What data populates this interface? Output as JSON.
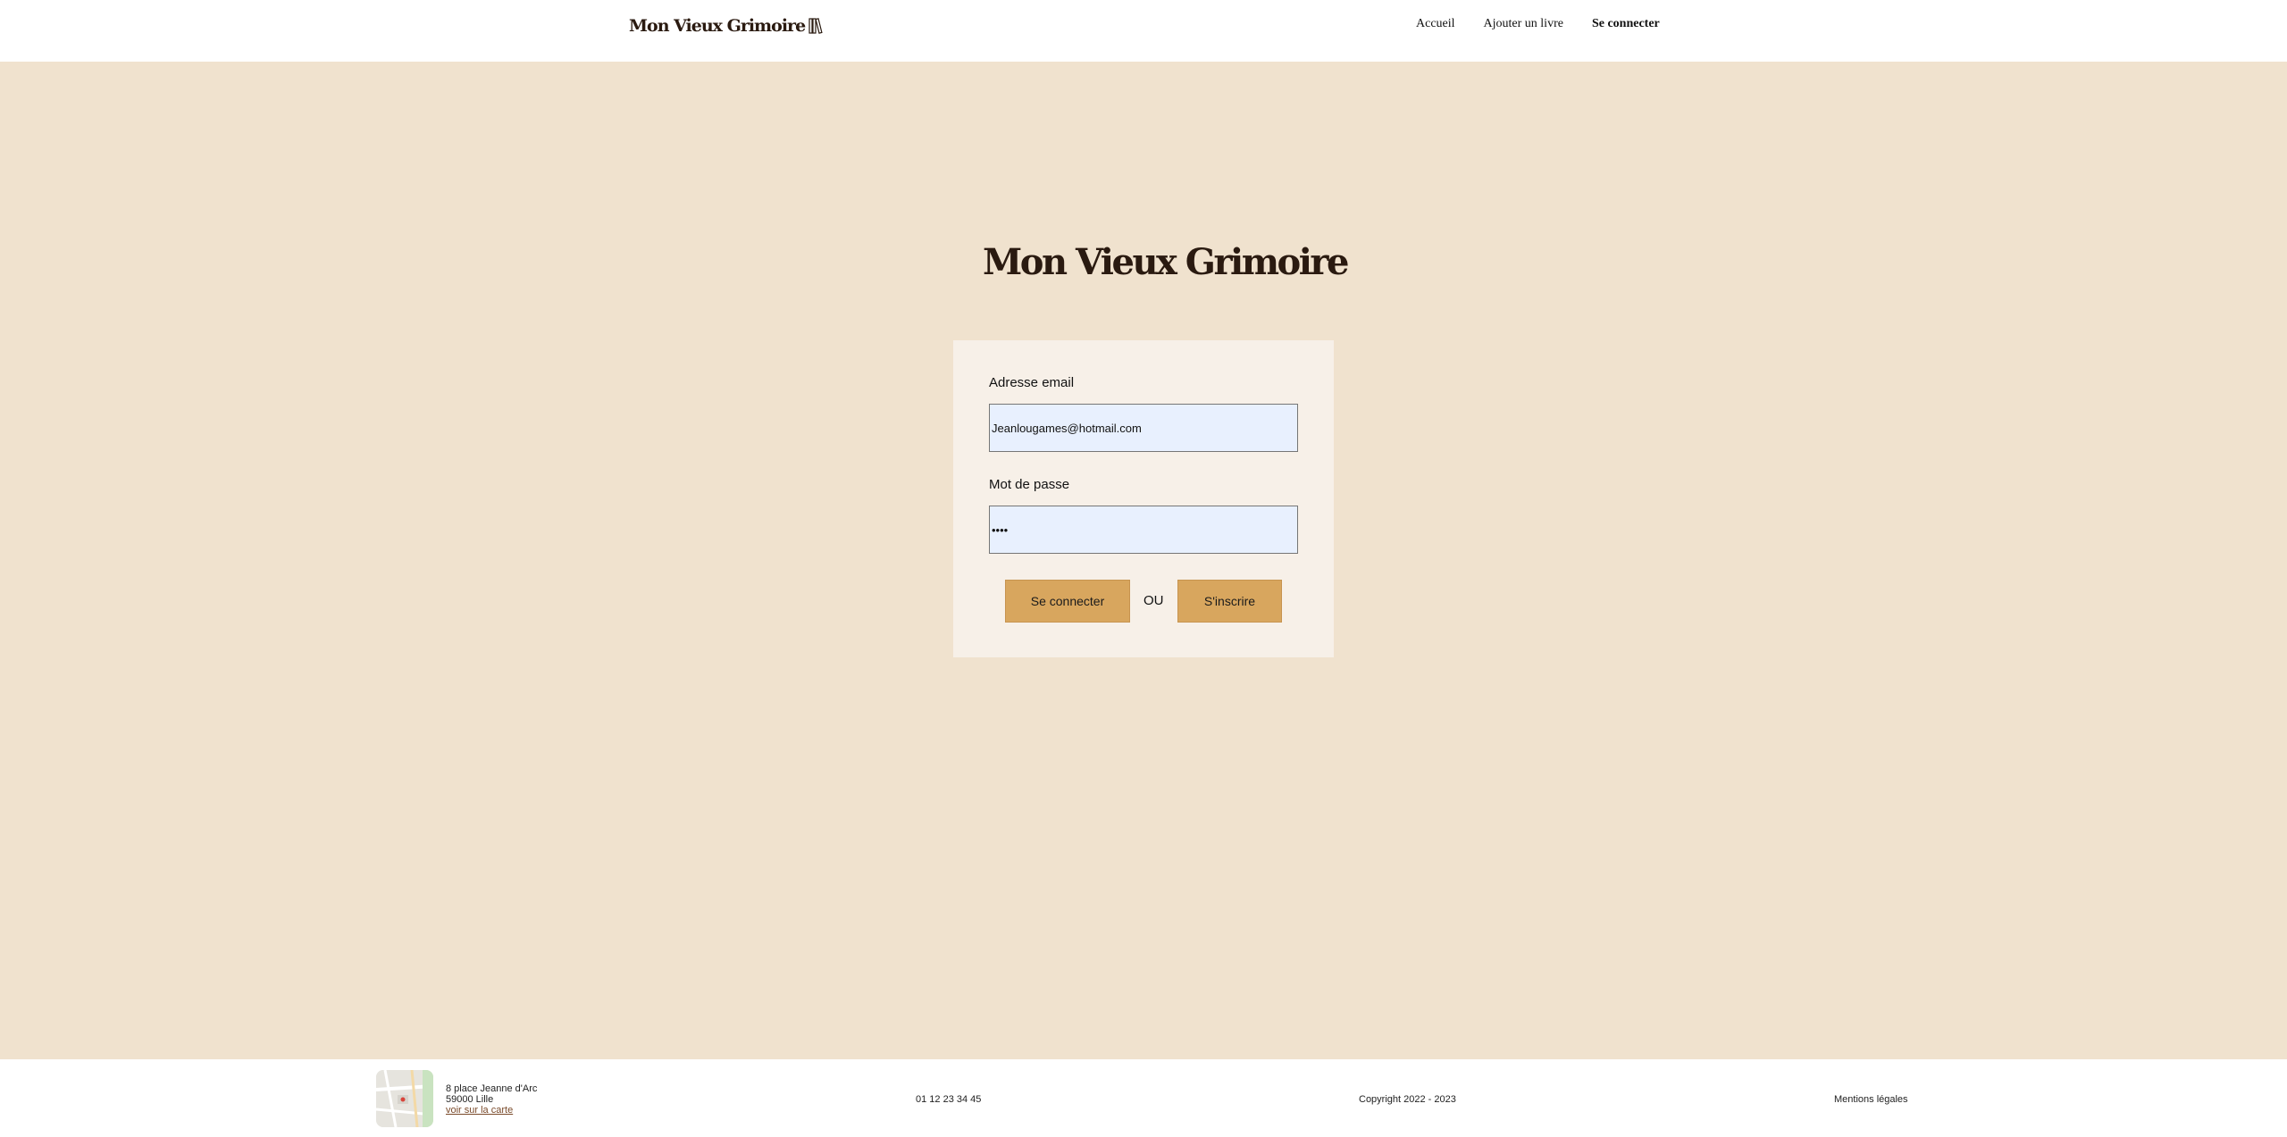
{
  "header": {
    "brand": "Mon Vieux Grimoire",
    "nav": {
      "home": "Accueil",
      "add_book": "Ajouter un livre",
      "login": "Se connecter"
    }
  },
  "main": {
    "brand": "Mon Vieux Grimoire"
  },
  "login_form": {
    "email_label": "Adresse email",
    "email_value": "Jeanlougames@hotmail.com",
    "password_label": "Mot de passe",
    "password_value": "••••",
    "login_button": "Se connecter",
    "or_text": "OU",
    "signup_button": "S'inscrire"
  },
  "footer": {
    "address_line1": "8 place Jeanne d'Arc",
    "address_line2": "59000 Lille",
    "map_link": "voir sur la carte",
    "phone": "01 12 23 34 45",
    "copyright": "Copyright 2022 - 2023",
    "legal": "Mentions légales"
  },
  "colors": {
    "page_background": "#f0e2ce",
    "card_background": "#f7f0e8",
    "button": "#d8a65e",
    "input_background": "#e8f0fe"
  }
}
